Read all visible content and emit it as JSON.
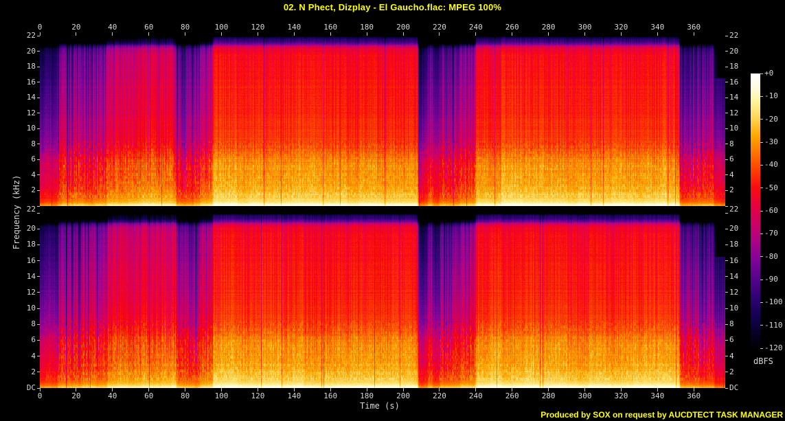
{
  "header": {
    "title": "02. N Phect, Dizplay - El Gaucho.flac: MPEG 100%"
  },
  "footer": {
    "credit": "Produced by SOX on request by AUCDTECT TASK MANAGER"
  },
  "axes": {
    "x": {
      "label": "Time (s)",
      "ticks": [
        0,
        20,
        40,
        60,
        80,
        100,
        120,
        140,
        160,
        180,
        200,
        220,
        240,
        260,
        280,
        300,
        320,
        340,
        360
      ],
      "range_s": [
        0,
        377.3
      ]
    },
    "y": {
      "label": "Frequency (kHz)",
      "ticks": [
        "22",
        "20",
        "18",
        "16",
        "14",
        "12",
        "10",
        "8",
        "6",
        "4",
        "2"
      ],
      "gap_label": "22",
      "dc_label": "DC",
      "range_khz": [
        0,
        22
      ]
    },
    "colorbar": {
      "label": "dBFS",
      "ticks": [
        "+0",
        "-10",
        "-20",
        "-30",
        "-40",
        "-50",
        "-60",
        "-70",
        "-80",
        "-90",
        "-100",
        "-110",
        "-120"
      ],
      "range_db": [
        0,
        -120
      ]
    }
  },
  "chart_data": {
    "type": "heatmap",
    "subtype": "audio-spectrogram",
    "title": "02. N Phect, Dizplay - El Gaucho.flac: MPEG 100%",
    "channels": [
      "left",
      "right"
    ],
    "xlabel": "Time (s)",
    "ylabel": "Frequency (kHz)",
    "zlabel": "dBFS",
    "x_range_s": [
      0,
      377.3
    ],
    "y_range_khz": [
      0,
      22
    ],
    "z_range_db": [
      0,
      -120
    ],
    "lowpass_cutoff_khz": 20.8,
    "palette_stops_db_hex": [
      [
        0,
        "#ffffff"
      ],
      [
        -6,
        "#fffce0"
      ],
      [
        -12,
        "#fff59e"
      ],
      [
        -20,
        "#ffd24e"
      ],
      [
        -27,
        "#ffa800"
      ],
      [
        -35,
        "#ff7100"
      ],
      [
        -42,
        "#ff3f00"
      ],
      [
        -50,
        "#fb0a10"
      ],
      [
        -58,
        "#e80040"
      ],
      [
        -66,
        "#cb0068"
      ],
      [
        -74,
        "#a80289"
      ],
      [
        -82,
        "#7c0498"
      ],
      [
        -90,
        "#53038c"
      ],
      [
        -98,
        "#2e0272"
      ],
      [
        -106,
        "#140152"
      ],
      [
        -113,
        "#070129"
      ],
      [
        -120,
        "#000000"
      ]
    ],
    "freq_profile_db": [
      [
        0,
        -2
      ],
      [
        0.25,
        -7
      ],
      [
        0.5,
        -15
      ],
      [
        0.8,
        -19
      ],
      [
        1.5,
        -22
      ],
      [
        2.5,
        -26
      ],
      [
        4,
        -29
      ],
      [
        5,
        -31
      ],
      [
        6,
        -34
      ],
      [
        7,
        -38
      ],
      [
        8,
        -41
      ],
      [
        10,
        -44
      ],
      [
        12,
        -46
      ],
      [
        14,
        -47
      ],
      [
        16,
        -48
      ],
      [
        18,
        -50
      ],
      [
        19.5,
        -51
      ],
      [
        20.3,
        -55
      ],
      [
        20.7,
        -66
      ],
      [
        21.0,
        -86
      ],
      [
        21.4,
        -97
      ],
      [
        21.8,
        -103
      ],
      [
        22,
        -108
      ]
    ],
    "segments_t0_t1_level_stripe": [
      [
        0,
        2.5,
        0.24,
        0.2
      ],
      [
        2.5,
        9.5,
        0.3,
        0.25
      ],
      [
        9.5,
        23,
        0.52,
        0.85
      ],
      [
        23,
        37,
        0.58,
        0.8
      ],
      [
        37,
        56,
        0.8,
        0.5
      ],
      [
        56,
        75,
        0.85,
        0.45
      ],
      [
        75,
        88,
        0.5,
        0.75
      ],
      [
        88,
        95,
        0.68,
        0.6
      ],
      [
        95,
        208,
        1.0,
        0.28
      ],
      [
        208,
        213.5,
        0.27,
        0.35
      ],
      [
        213.5,
        216,
        0.5,
        0.5
      ],
      [
        216,
        220,
        0.3,
        0.4
      ],
      [
        220,
        231,
        0.5,
        0.8
      ],
      [
        231,
        240,
        0.62,
        0.7
      ],
      [
        240,
        352,
        1.0,
        0.28
      ],
      [
        352,
        371,
        0.45,
        0.75
      ],
      [
        371,
        377.3,
        0.22,
        0.3
      ]
    ],
    "end_fade": {
      "t_start_s": 371,
      "notch_above_khz": 16.5
    }
  }
}
